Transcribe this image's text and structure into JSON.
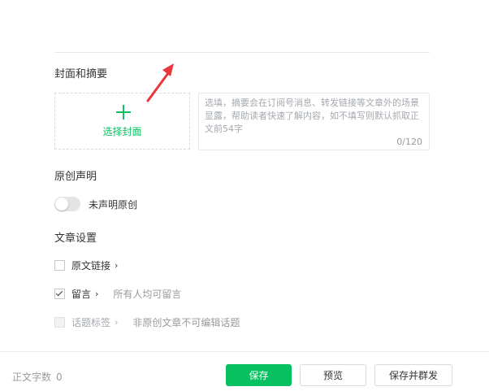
{
  "cover_section": {
    "title": "封面和摘要",
    "select_cover_label": "选择封面"
  },
  "summary": {
    "placeholder": "选填，摘要会在订阅号消息、转发链接等文章外的场景显露，帮助读者快速了解内容，如不填写则默认抓取正文前54字",
    "value": "",
    "counter": "0/120"
  },
  "original_section": {
    "title": "原创声明",
    "toggle_on": false,
    "toggle_label": "未声明原创"
  },
  "settings_section": {
    "title": "文章设置",
    "original_link": {
      "label": "原文链接",
      "chevron": "›",
      "checked": false
    },
    "comments": {
      "label": "留言",
      "chevron": "›",
      "checked": true,
      "note": "所有人均可留言"
    },
    "topic_tags": {
      "label": "话题标签",
      "chevron": "›",
      "disabled": true,
      "note": "非原创文章不可编辑话题"
    }
  },
  "footer": {
    "word_count_label": "正文字数",
    "word_count_value": "0",
    "save_label": "保存",
    "preview_label": "预览",
    "publish_label": "保存并群发"
  },
  "colors": {
    "accent": "#07c160",
    "annotation_arrow": "#e8373a"
  },
  "icons": [
    "plus-icon",
    "annotation-arrow-icon",
    "checkmark-icon",
    "chevron-right-icon"
  ]
}
